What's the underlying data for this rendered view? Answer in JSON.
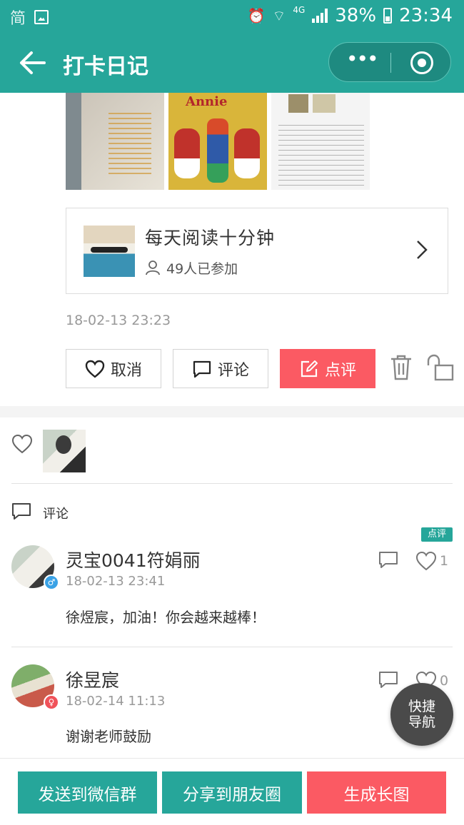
{
  "status_bar": {
    "left_glyph": "简",
    "network": "4G",
    "battery": "38%",
    "time": "23:34"
  },
  "nav": {
    "title": "打卡日记",
    "more_label": "•••"
  },
  "photos": {
    "photo2_caption": "Annie"
  },
  "activity": {
    "title": "每天阅读十分钟",
    "joined": "49人已参加"
  },
  "post": {
    "timestamp": "18-02-13 23:23"
  },
  "actions": {
    "cancel": "取消",
    "comment": "评论",
    "review": "点评"
  },
  "comments_section": {
    "label": "评论",
    "review_badge": "点评",
    "items": [
      {
        "name": "灵宝0041符娟丽",
        "time": "18-02-13 23:41",
        "text": "徐煜宸，加油！你会越来越棒！",
        "likes": "1",
        "gender": "♂"
      },
      {
        "name": "徐昱宸",
        "time": "18-02-14 11:13",
        "text": "谢谢老师鼓励",
        "likes": "0",
        "gender": "♀"
      }
    ]
  },
  "quick_nav": {
    "line1": "快捷",
    "line2": "导航"
  },
  "bottom_bar": {
    "send_group": "发送到微信群",
    "share_moments": "分享到朋友圈",
    "gen_image": "生成长图"
  },
  "colors": {
    "primary": "#26a69a",
    "accent": "#fb5a63"
  }
}
